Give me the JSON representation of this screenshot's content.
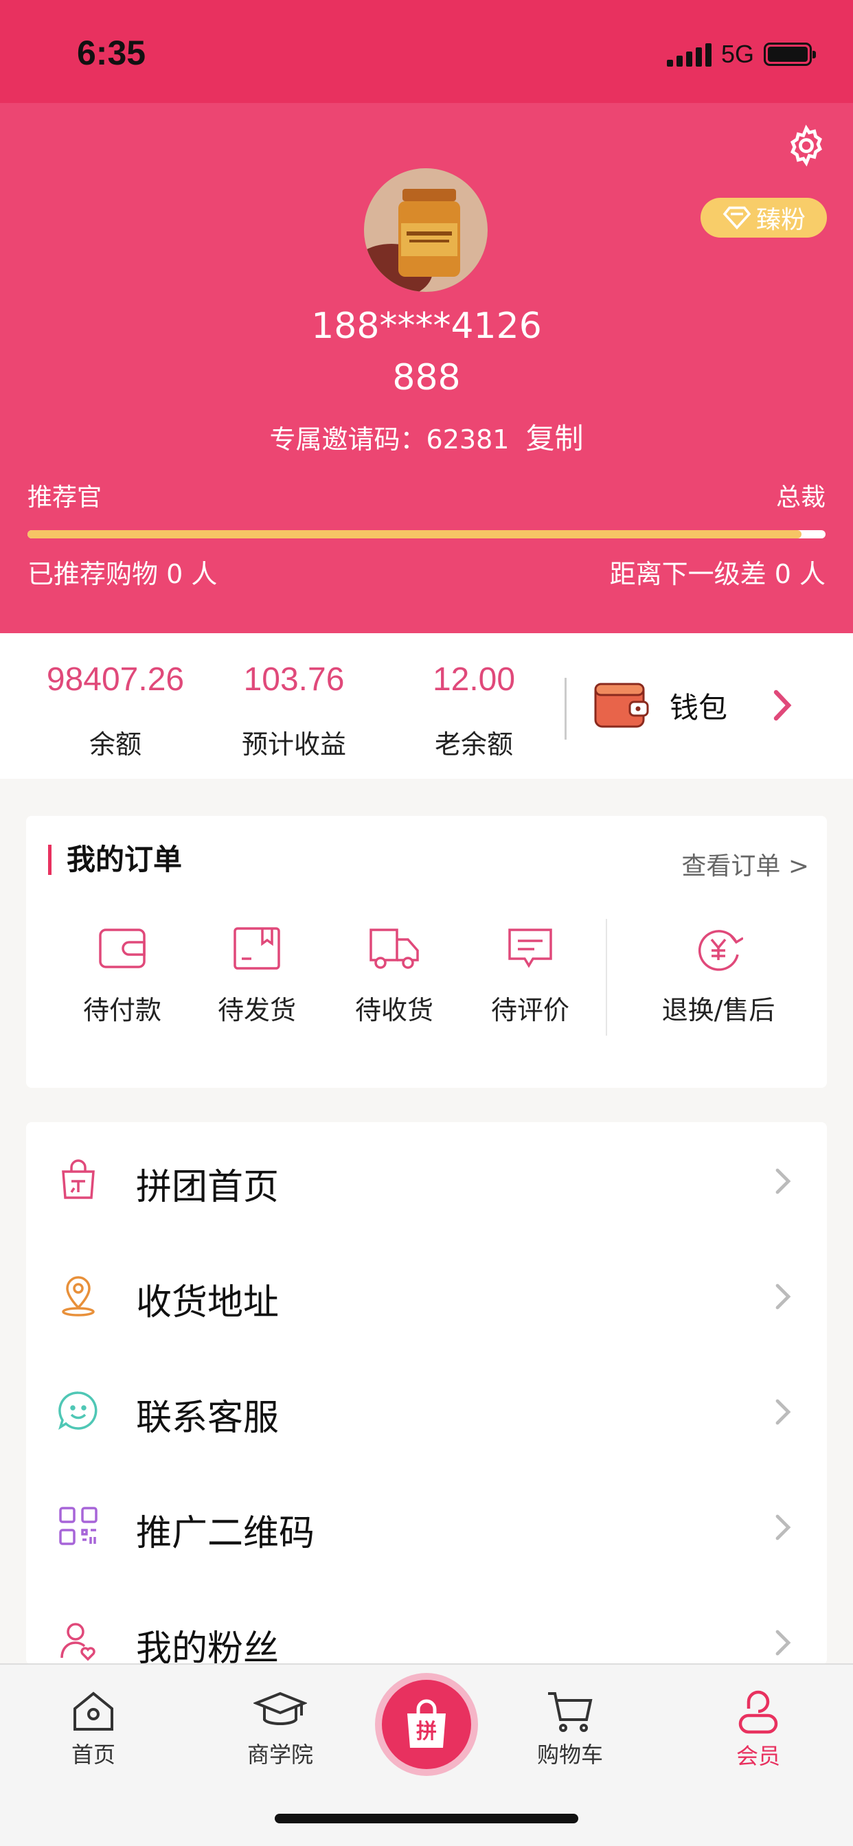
{
  "status_bar": {
    "time": "6:35",
    "network": "5G"
  },
  "profile": {
    "level_badge": "臻粉",
    "phone": "188****4126",
    "nickname": "888",
    "invite_label": "专属邀请码：62381",
    "copy_label": "复制",
    "rank_current": "推荐官",
    "rank_next": "总裁",
    "progress": 0.97,
    "recommended_text": "已推荐购物 0 人",
    "next_level_text": "距离下一级差 0 人"
  },
  "balances": {
    "items": [
      {
        "value": "98407.26",
        "label": "余额"
      },
      {
        "value": "103.76",
        "label": "预计收益"
      },
      {
        "value": "12.00",
        "label": "老余额"
      }
    ],
    "wallet_label": "钱包"
  },
  "orders": {
    "title": "我的订单",
    "view_all": "查看订单 >",
    "items": [
      {
        "label": "待付款",
        "icon": "wallet-icon"
      },
      {
        "label": "待发货",
        "icon": "package-icon"
      },
      {
        "label": "待收货",
        "icon": "truck-icon"
      },
      {
        "label": "待评价",
        "icon": "comment-icon"
      },
      {
        "label": "退换/售后",
        "icon": "refund-icon"
      }
    ]
  },
  "menu": {
    "items": [
      {
        "label": "拼团首页",
        "icon": "shopping-bag-icon",
        "color": "#e0497a"
      },
      {
        "label": "收货地址",
        "icon": "location-pin-icon",
        "color": "#e8903a"
      },
      {
        "label": "联系客服",
        "icon": "smile-chat-icon",
        "color": "#4fc7b5"
      },
      {
        "label": "推广二维码",
        "icon": "qr-code-icon",
        "color": "#a765d8"
      },
      {
        "label": "我的粉丝",
        "icon": "user-heart-icon",
        "color": "#e0497a"
      }
    ]
  },
  "tabbar": {
    "items": [
      {
        "label": "首页",
        "icon": "home-icon"
      },
      {
        "label": "商学院",
        "icon": "graduation-cap-icon"
      },
      {
        "label": "拼",
        "icon": "group-buy-icon"
      },
      {
        "label": "购物车",
        "icon": "cart-icon"
      },
      {
        "label": "会员",
        "icon": "member-icon"
      }
    ],
    "active": "会员"
  },
  "colors": {
    "primary": "#e8315f",
    "header": "#ec4672",
    "accent": "#e0497a",
    "gold": "#f8cd69"
  }
}
